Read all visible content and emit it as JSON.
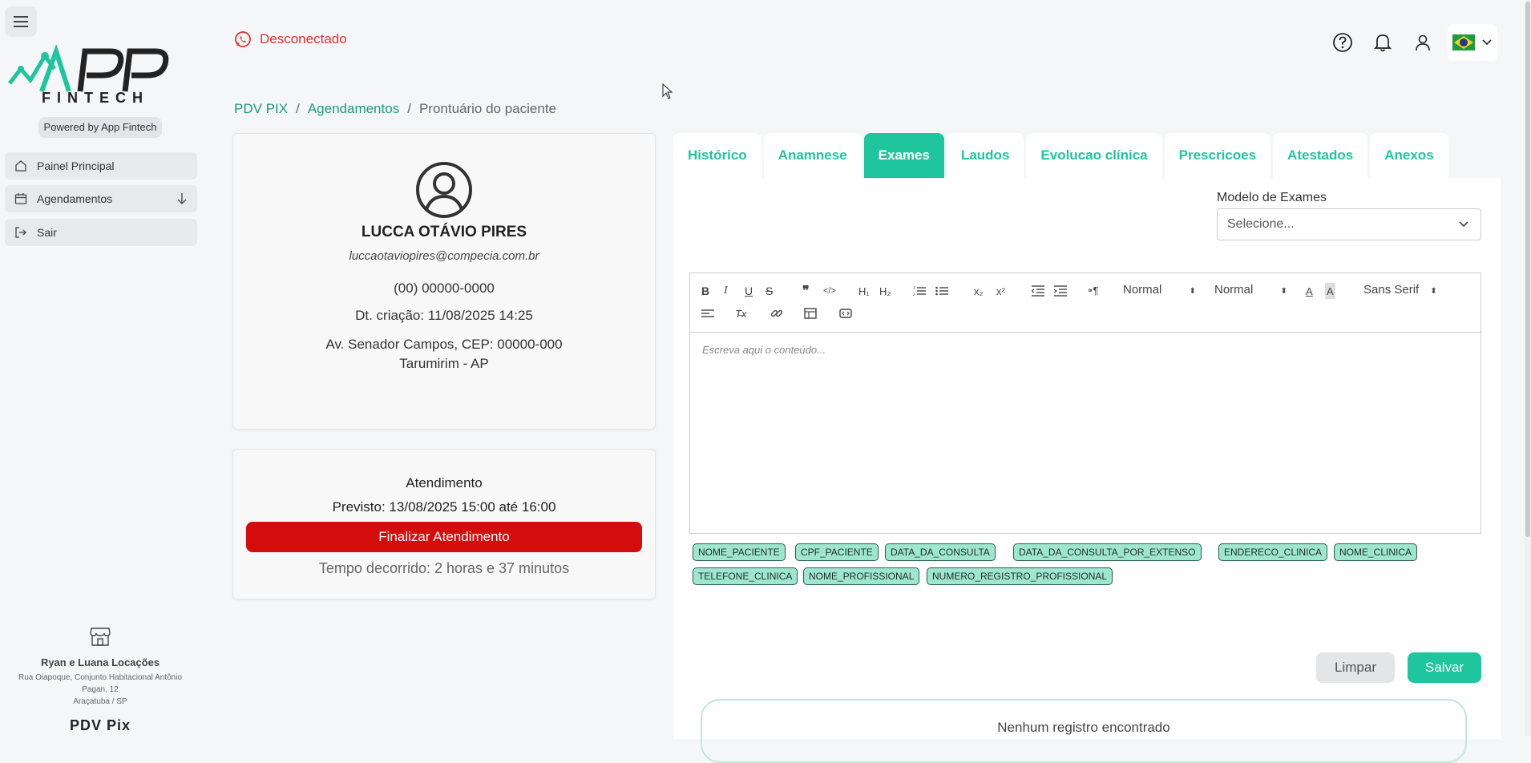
{
  "header": {
    "status_text": "Desconectado"
  },
  "sidebar": {
    "logo_text": "FINTECH",
    "powered_by": "Powered by App Fintech",
    "items": [
      {
        "label": "Painel Principal"
      },
      {
        "label": "Agendamentos"
      },
      {
        "label": "Sair"
      }
    ],
    "store": {
      "name": "Ryan e Luana Locações",
      "address_line1": "Rua Oiapoque, Conjunto Habitacional Antônio",
      "address_line2": "Pagan, 12",
      "city": "Araçatuba / SP",
      "footer": "PDV Pix"
    }
  },
  "breadcrumb": {
    "items": [
      "PDV PIX",
      "Agendamentos",
      "Prontuário do paciente"
    ],
    "separator": "/"
  },
  "patient": {
    "name": "LUCCA OTÁVIO PIRES",
    "email": "luccaotaviopires@compecia.com.br",
    "phone": "(00) 00000-0000",
    "created": "Dt. criação: 11/08/2025 14:25",
    "address_line1": "Av. Senador Campos, CEP: 00000-000",
    "address_line2": "Tarumirim - AP"
  },
  "attendance": {
    "title": "Atendimento",
    "planned": "Previsto: 13/08/2025 15:00 até 16:00",
    "finish_label": "Finalizar Atendimento",
    "elapsed": "Tempo decorrido: 2 horas e 37 minutos"
  },
  "tabs": [
    {
      "label": "Histórico"
    },
    {
      "label": "Anamnese"
    },
    {
      "label": "Exames",
      "active": true
    },
    {
      "label": "Laudos"
    },
    {
      "label": "Evolucao clínica"
    },
    {
      "label": "Prescricoes"
    },
    {
      "label": "Atestados"
    },
    {
      "label": "Anexos"
    }
  ],
  "exams": {
    "model_label": "Modelo de Exames",
    "model_placeholder": "Selecione...",
    "toolbar": {
      "header_select": "Normal",
      "size_select": "Normal",
      "font_select": "Sans Serif"
    },
    "editor_placeholder": "Escreva aqui o conteúdo...",
    "chips": [
      "NOME_PACIENTE",
      "CPF_PACIENTE",
      "DATA_DA_CONSULTA",
      "DATA_DA_CONSULTA_POR_EXTENSO",
      "ENDERECO_CLINICA",
      "NOME_CLINICA",
      "TELEFONE_CLINICA",
      "NOME_PROFISSIONAL",
      "NUMERO_REGISTRO_PROFISSIONAL"
    ],
    "clear_label": "Limpar",
    "save_label": "Salvar",
    "empty_text": "Nenhum registro encontrado"
  },
  "colors": {
    "accent": "#1fc59d",
    "danger": "#d40c0c",
    "status_red": "#e0322d",
    "link_green": "#1a9c7d"
  }
}
